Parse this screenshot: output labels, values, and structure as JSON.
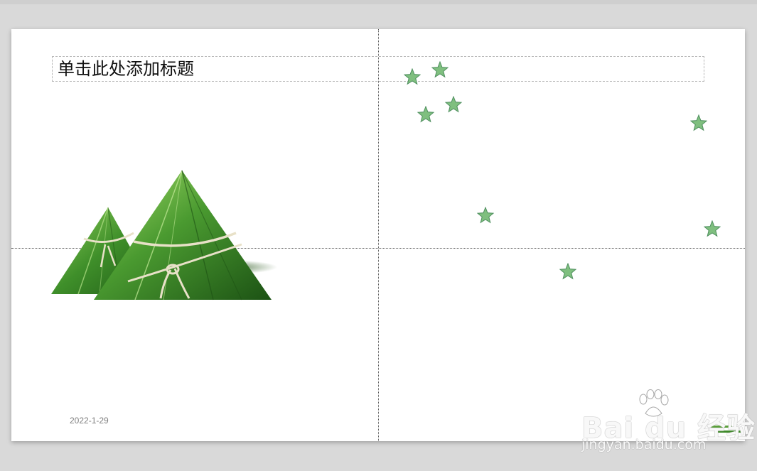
{
  "slide": {
    "title_placeholder": "单击此处添加标题",
    "date": "2022-1-29"
  },
  "decorations": {
    "star_color": "#7fbf7f",
    "star_stroke": "#4f8f5f",
    "image": "zongzi-illustration"
  },
  "watermark": {
    "brand": "Bai du 经验",
    "url": "jingyan.baidu.com"
  },
  "colors": {
    "background": "#d9d9d9",
    "slide": "#ffffff",
    "leaf_dark": "#2f6e21",
    "leaf_light": "#7cbf4a",
    "string": "#e8e1c8"
  }
}
